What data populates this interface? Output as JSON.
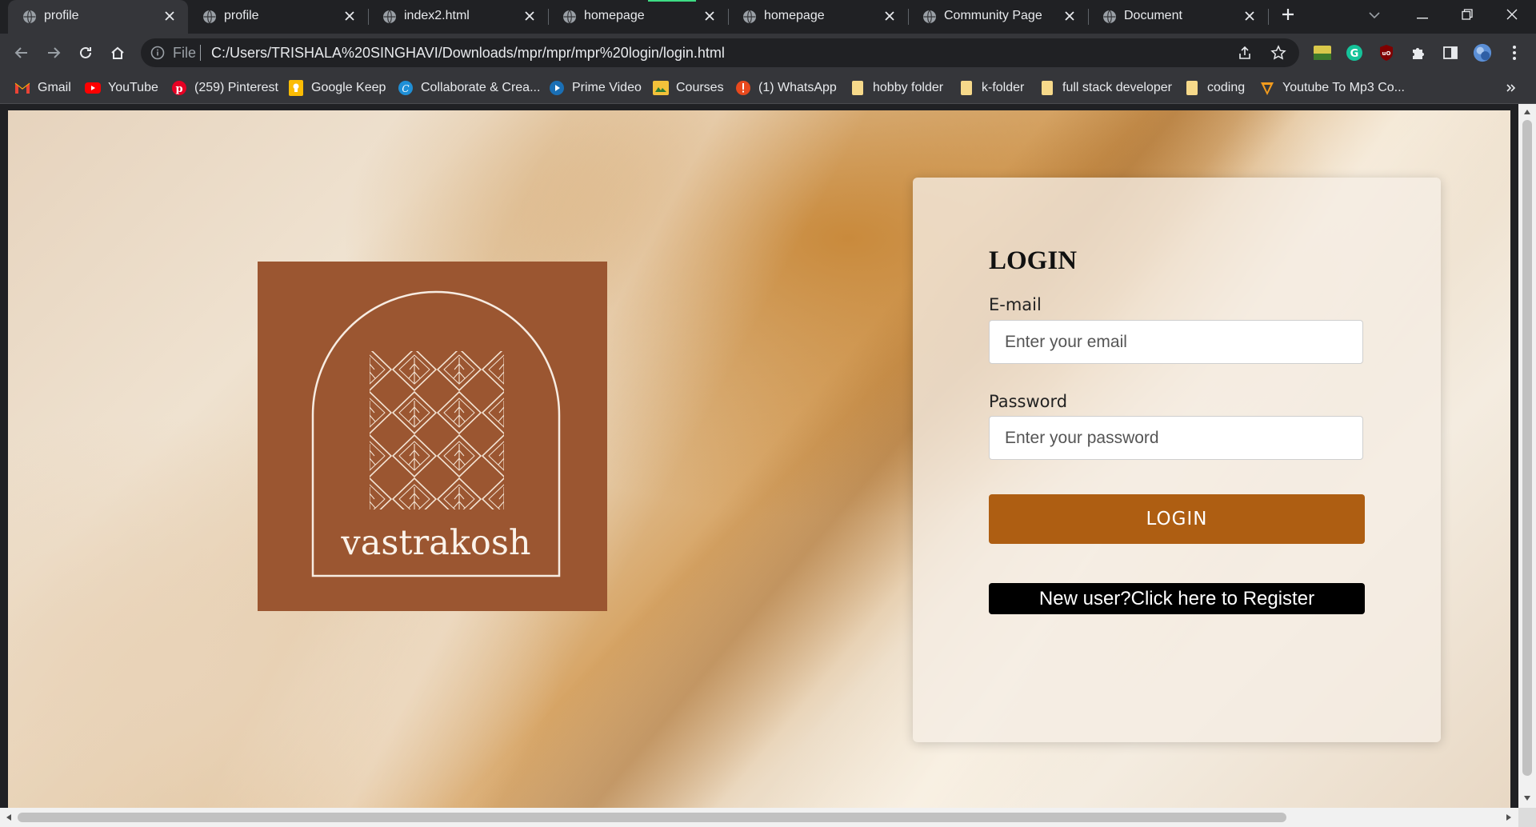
{
  "browser": {
    "tabs": [
      {
        "title": "profile",
        "active": true
      },
      {
        "title": "profile",
        "active": false
      },
      {
        "title": "index2.html",
        "active": false
      },
      {
        "title": "homepage",
        "active": false
      },
      {
        "title": "homepage",
        "active": false
      },
      {
        "title": "Community Page",
        "active": false
      },
      {
        "title": "Document",
        "active": false
      }
    ],
    "address_bar": {
      "scheme_label": "File",
      "url": "C:/Users/TRISHALA%20SINGHAVI/Downloads/mpr/mpr/mpr%20login/login.html"
    },
    "bookmarks": [
      {
        "label": "Gmail",
        "icon": "gmail-icon"
      },
      {
        "label": "YouTube",
        "icon": "youtube-icon"
      },
      {
        "label": "(259) Pinterest",
        "icon": "pinterest-icon"
      },
      {
        "label": "Google Keep",
        "icon": "google-keep-icon"
      },
      {
        "label": "Collaborate & Crea...",
        "icon": "canva-icon"
      },
      {
        "label": "Prime Video",
        "icon": "prime-video-icon"
      },
      {
        "label": "Courses",
        "icon": "courses-icon"
      },
      {
        "label": "(1) WhatsApp",
        "icon": "whatsapp-icon"
      },
      {
        "label": "hobby folder",
        "icon": "folder-icon"
      },
      {
        "label": "k-folder",
        "icon": "folder-icon"
      },
      {
        "label": "full stack developer",
        "icon": "folder-icon"
      },
      {
        "label": "coding",
        "icon": "folder-icon"
      },
      {
        "label": "Youtube To Mp3 Co...",
        "icon": "mp3-converter-icon"
      }
    ],
    "colors": {
      "frame": "#202124",
      "toolbar": "#35363a",
      "text": "#e8eaed"
    }
  },
  "page": {
    "brand": {
      "name": "vastrakosh",
      "color": "#9b5631"
    },
    "login": {
      "title": "LOGIN",
      "email_label": "E-mail",
      "email_placeholder": "Enter your email",
      "password_label": "Password",
      "password_placeholder": "Enter your password",
      "login_button": "LOGIN",
      "register_button": "New user?Click here to Register"
    },
    "colors": {
      "login_button": "#ae5e12",
      "register_button": "#000000"
    }
  }
}
